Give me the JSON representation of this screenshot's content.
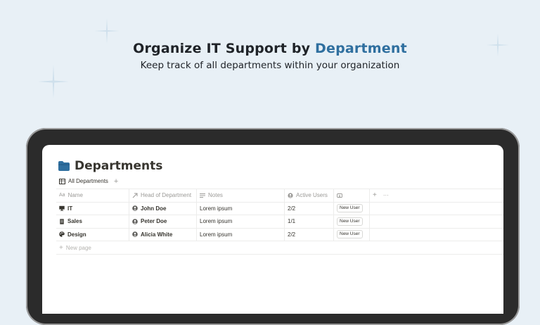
{
  "hero": {
    "title_part1": "Organize IT Support by ",
    "title_accent": "Department",
    "subtitle": "Keep track of all departments within your organization"
  },
  "page": {
    "title": "Departments",
    "icon": "folder-icon"
  },
  "views": {
    "active_view": "All Departments",
    "add_view": "+"
  },
  "table": {
    "columns": [
      {
        "label": "Name",
        "icon": "text-property-icon"
      },
      {
        "label": "Head of Department",
        "icon": "relation-arrow-icon"
      },
      {
        "label": "Notes",
        "icon": "lines-icon"
      },
      {
        "label": "Active Users",
        "icon": "person-circle-icon"
      },
      {
        "label": "",
        "icon": "button-property-icon"
      }
    ],
    "add_column": "+",
    "more": "···",
    "rows": [
      {
        "icon": "monitor-icon",
        "name": "IT",
        "head": "John Doe",
        "notes": "Lorem ipsum",
        "active_users": "2/2",
        "button": "New User"
      },
      {
        "icon": "document-icon",
        "name": "Sales",
        "head": "Peter Doe",
        "notes": "Lorem ipsum",
        "active_users": "1/1",
        "button": "New User"
      },
      {
        "icon": "palette-icon",
        "name": "Design",
        "head": "Alicia White",
        "notes": "Lorem ipsum",
        "active_users": "2/2",
        "button": "New User"
      }
    ],
    "new_page": "New page"
  },
  "colors": {
    "background": "#e8f0f6",
    "accent": "#2f6f9f",
    "folder": "#2f6f9f"
  }
}
